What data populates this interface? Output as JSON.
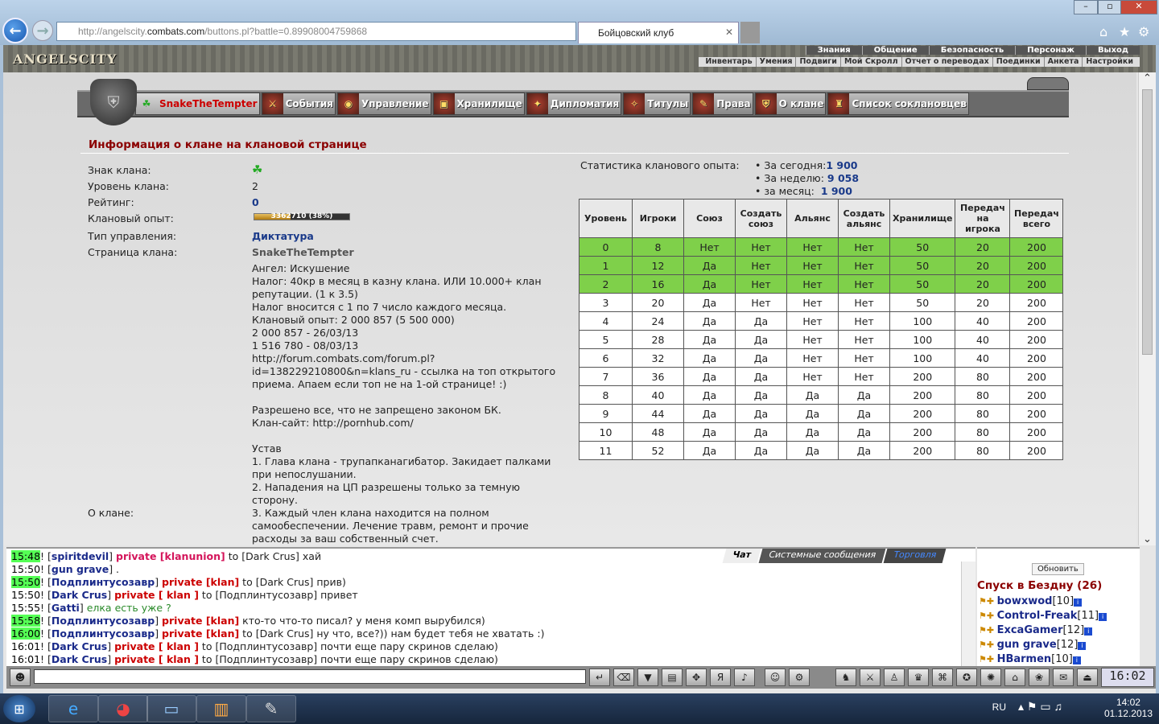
{
  "browser": {
    "url_grey": "http://angelscity.",
    "url_host": "combats.com",
    "url_rest": "/buttons.pl?battle=0.89908004759868",
    "tab_title": "Бойцовский клуб"
  },
  "topnav": {
    "row1": [
      "Знания",
      "Общение",
      "Безопасность",
      "Персонаж",
      "Выход"
    ],
    "row2": [
      "Инвентарь",
      "Умения",
      "Подвиги",
      "Мой Скролл",
      "Отчет о переводах",
      "Поединки",
      "Анкета",
      "Настройки"
    ]
  },
  "logo": "ANGELSCITY",
  "clan_tabs": [
    "SnakeTheTempter",
    "События",
    "Управление",
    "Хранилище",
    "Дипломатия",
    "Титулы",
    "Права",
    "О клане",
    "Список соклановцев"
  ],
  "section_title": "Информация о клане на клановой странице",
  "info": {
    "labels": [
      "Знак клана:",
      "Уровень клана:",
      "Рейтинг:",
      "Клановый опыт:",
      "Тип управления:",
      "Страница клана:",
      "О клане:"
    ],
    "level": "2",
    "rating": "0",
    "exp_text": "3362710 (38%)",
    "exp_fraction": 0.38,
    "govern": "Диктатура",
    "page": "SnakeTheTempter",
    "about": "Ангел: Искушение\nНалог: 40кр в месяц в казну клана. ИЛИ 10.000+ клан\nрепутации. (1 к 3.5)\nНалог вносится с 1 по 7 число каждого месяца.\nКлановый опыт: 2 000 857 (5 500 000)\n2 000 857 - 26/03/13\n1 516 780 - 08/03/13\nhttp://forum.combats.com/forum.pl?\nid=138229210800&n=klans_ru - ссылка на топ открытого\nприема. Апаем если топ не на 1-ой странице! :)\n\nРазрешено все, что не запрещено законом БК.\nКлан-сайт: http://pornhub.com/\n\nУстав\n1. Глава клана - трупапканагибатор. Закидает палками\nпри непослушании.\n2. Нападения на ЦП разрешены только за темную\nсторону.\n3. Каждый член клана находится на полном\nсамообеспечении. Лечение травм, ремонт и прочие\nрасходы за ваш собственный счет."
  },
  "stats": {
    "label": "Статистика кланового опыта:",
    "today_l": "• За сегодня:",
    "today": "1 900",
    "week_l": "• За неделю:",
    "week": "9 058",
    "month_l": "• за месяц:",
    "month": "1 900"
  },
  "table": {
    "headers": [
      "Уровень",
      "Игроки",
      "Союз",
      "Создать союз",
      "Альянс",
      "Создать альянс",
      "Хранилище",
      "Передач на игрока",
      "Передач всего"
    ],
    "rows": [
      [
        "0",
        "8",
        "Нет",
        "Нет",
        "Нет",
        "Нет",
        "50",
        "20",
        "200"
      ],
      [
        "1",
        "12",
        "Да",
        "Нет",
        "Нет",
        "Нет",
        "50",
        "20",
        "200"
      ],
      [
        "2",
        "16",
        "Да",
        "Нет",
        "Нет",
        "Нет",
        "50",
        "20",
        "200"
      ],
      [
        "3",
        "20",
        "Да",
        "Нет",
        "Нет",
        "Нет",
        "50",
        "20",
        "200"
      ],
      [
        "4",
        "24",
        "Да",
        "Да",
        "Нет",
        "Нет",
        "100",
        "40",
        "200"
      ],
      [
        "5",
        "28",
        "Да",
        "Да",
        "Нет",
        "Нет",
        "100",
        "40",
        "200"
      ],
      [
        "6",
        "32",
        "Да",
        "Да",
        "Нет",
        "Нет",
        "100",
        "40",
        "200"
      ],
      [
        "7",
        "36",
        "Да",
        "Да",
        "Нет",
        "Нет",
        "200",
        "80",
        "200"
      ],
      [
        "8",
        "40",
        "Да",
        "Да",
        "Да",
        "Да",
        "200",
        "80",
        "200"
      ],
      [
        "9",
        "44",
        "Да",
        "Да",
        "Да",
        "Да",
        "200",
        "80",
        "200"
      ],
      [
        "10",
        "48",
        "Да",
        "Да",
        "Да",
        "Да",
        "200",
        "80",
        "200"
      ],
      [
        "11",
        "52",
        "Да",
        "Да",
        "Да",
        "Да",
        "200",
        "80",
        "200"
      ]
    ],
    "highlight_color": "#7fd04a"
  },
  "chat_tabs": [
    "Чат",
    "Системные сообщения",
    "Торговля"
  ],
  "chat": [
    {
      "t": "15:48",
      "n": "spiritdevil",
      "p": "private [klanunion]",
      "pc": "pm",
      "m": " to [Dark Crus] хай",
      "hl": true
    },
    {
      "t": "15:50",
      "n": "gun grave",
      "p": "",
      "pc": "",
      "m": " .",
      "hl": false
    },
    {
      "t": "15:50",
      "n": "Подплинтусозавр",
      "p": "private [klan]",
      "pc": "pr",
      "m": " to [Dark Crus] прив)",
      "hl": true
    },
    {
      "t": "15:50",
      "n": "Dark Crus",
      "p": "private [ klan ]",
      "pc": "pr",
      "m": " to [Подплинтусозавр] привет",
      "hl": false
    },
    {
      "t": "15:55",
      "n": "Gatti",
      "p": "",
      "pc": "",
      "m": " елка есть уже ?",
      "hl": false,
      "green": true
    },
    {
      "t": "15:58",
      "n": "Подплинтусозавр",
      "p": "private [klan]",
      "pc": "pr",
      "m": " кто-то что-то писал? у меня комп вырубился)",
      "hl": true
    },
    {
      "t": "16:00",
      "n": "Подплинтусозавр",
      "p": "private [klan]",
      "pc": "pr",
      "m": " to [Dark Crus] ну что, все?)) нам будет тебя не хватать :)",
      "hl": true
    },
    {
      "t": "16:01",
      "n": "Dark Crus",
      "p": "private [ klan ]",
      "pc": "pr",
      "m": " to [Подплинтусозавр] почти еще пару скринов сделаю)",
      "hl": false
    },
    {
      "t": "16:01",
      "n": "Dark Crus",
      "p": "private [ klan ]",
      "pc": "pr",
      "m": " to [Подплинтусозавр] почти еще пару скринов сделаю)",
      "hl": false
    }
  ],
  "room": {
    "refresh": "Обновить",
    "title": "Спуск в Бездну (26)",
    "players": [
      {
        "n": "bowxwod",
        "l": "[10]"
      },
      {
        "n": "Control-Freak",
        "l": "[11]"
      },
      {
        "n": "ExcaGamer",
        "l": "[12]"
      },
      {
        "n": "gun grave",
        "l": "[12]"
      },
      {
        "n": "HBarmen",
        "l": "[10]"
      }
    ]
  },
  "game_clock": "16:02",
  "taskbar": {
    "lang": "RU",
    "time": "14:02",
    "date": "01.12.2013"
  }
}
